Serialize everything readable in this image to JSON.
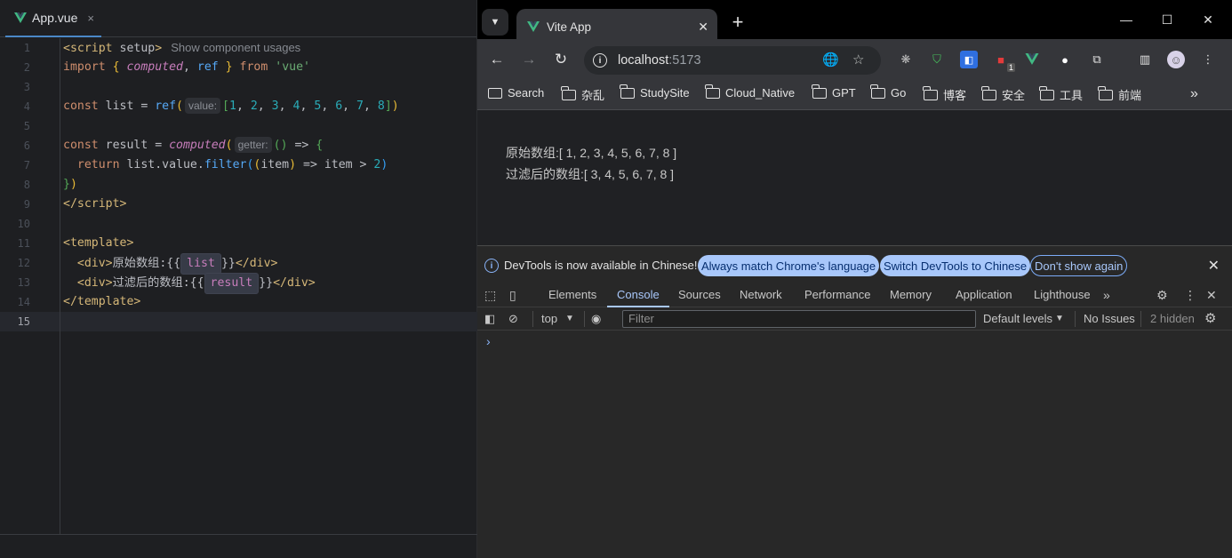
{
  "editor": {
    "tab_label": "App.vue",
    "tab_close": "×",
    "line_numbers": [
      "1",
      "2",
      "3",
      "4",
      "5",
      "6",
      "7",
      "8",
      "9",
      "10",
      "11",
      "12",
      "13",
      "14",
      "15"
    ],
    "hint_usages": "Show component usages",
    "hint_value": "value:",
    "hint_getter": "getter:",
    "var_list": "list",
    "var_result": "result",
    "text_original": "原始数组:",
    "text_filtered": "过滤后的数组:"
  },
  "browser": {
    "tab_title": "Vite App",
    "url_host": "localhost",
    "url_port": ":5173",
    "bookmarks": [
      "Search",
      "杂乱",
      "StudySite",
      "Cloud_Native",
      "GPT",
      "Go",
      "博客",
      "安全",
      "工具",
      "前端"
    ],
    "ext_badge": "1",
    "page": {
      "line1": "原始数组:[ 1, 2, 3, 4, 5, 6, 7, 8 ]",
      "line2": "过滤后的数组:[ 3, 4, 5, 6, 7, 8 ]"
    }
  },
  "devtools": {
    "banner_msg": "DevTools is now available in Chinese!",
    "banner_btn1": "Always match Chrome's language",
    "banner_btn2": "Switch DevTools to Chinese",
    "banner_btn3": "Don't show again",
    "tabs": [
      "Elements",
      "Console",
      "Sources",
      "Network",
      "Performance",
      "Memory",
      "Application",
      "Lighthouse"
    ],
    "context": "top",
    "filter_placeholder": "Filter",
    "levels": "Default levels",
    "issues": "No Issues",
    "hidden": "2 hidden",
    "prompt": "›"
  },
  "colors": {
    "accent": "#a8c7fa",
    "vue_green": "#41b883",
    "tab_underline": "#4a88c7"
  }
}
